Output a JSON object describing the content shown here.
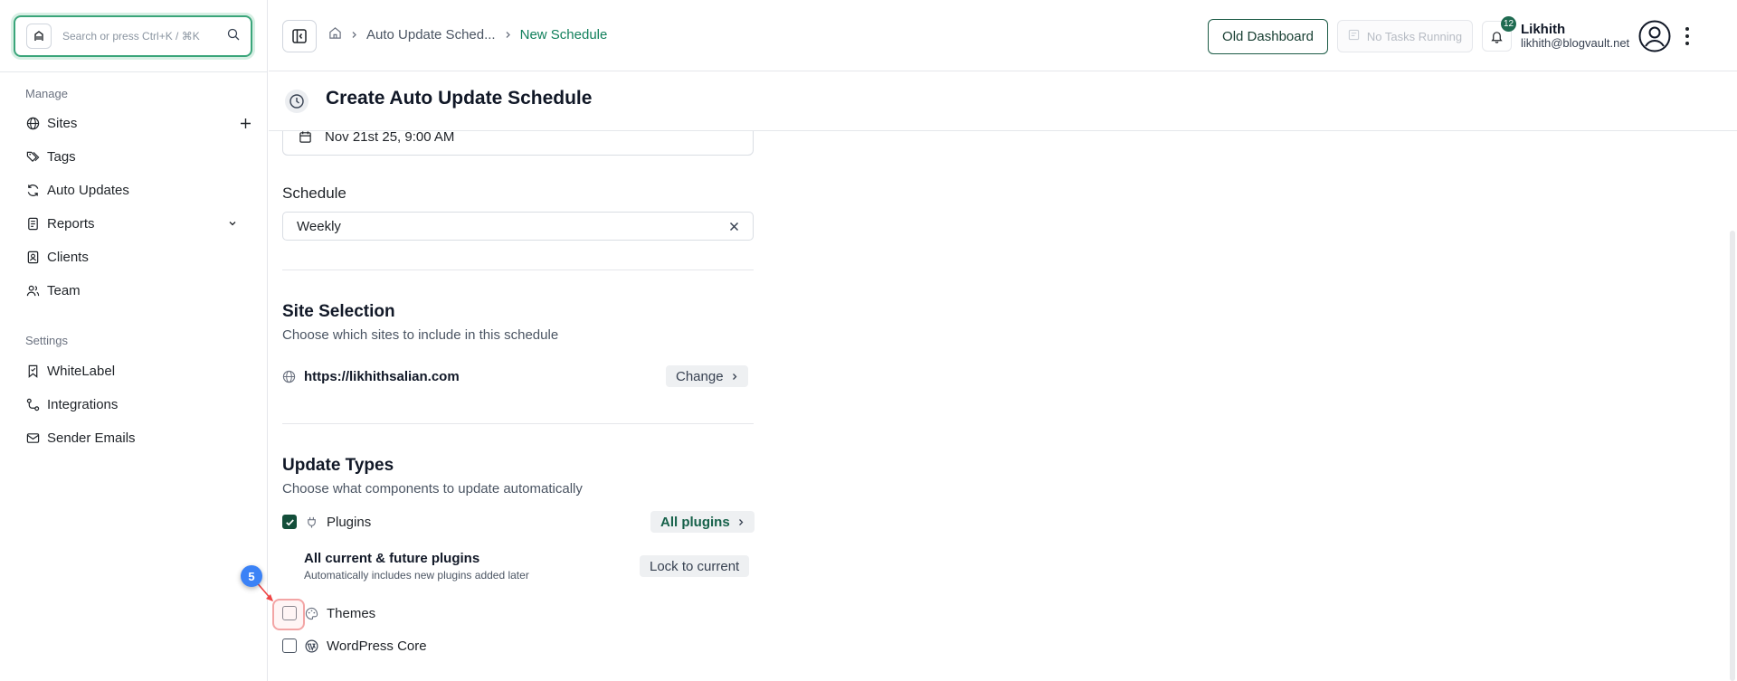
{
  "search": {
    "placeholder": "Search or press Ctrl+K / ⌘K"
  },
  "sidebar": {
    "manage_label": "Manage",
    "manage_items": [
      {
        "label": "Sites",
        "icon": "globe-icon",
        "trail": "plus-icon"
      },
      {
        "label": "Tags",
        "icon": "tags-icon"
      },
      {
        "label": "Auto Updates",
        "icon": "refresh-icon"
      },
      {
        "label": "Reports",
        "icon": "report-icon",
        "trail": "chevron-down-icon"
      },
      {
        "label": "Clients",
        "icon": "contact-icon"
      },
      {
        "label": "Team",
        "icon": "users-icon"
      }
    ],
    "settings_label": "Settings",
    "settings_items": [
      {
        "label": "WhiteLabel",
        "icon": "bookmark-icon"
      },
      {
        "label": "Integrations",
        "icon": "route-icon"
      },
      {
        "label": "Sender Emails",
        "icon": "mail-icon"
      }
    ]
  },
  "header": {
    "breadcrumb": {
      "parent": "Auto Update Sched...",
      "current": "New Schedule"
    },
    "old_dashboard": "Old Dashboard",
    "tasks_status": "No Tasks Running",
    "notification_count": "12",
    "user": {
      "name": "Likhith",
      "email": "likhith@blogvault.net"
    }
  },
  "page": {
    "title": "Create Auto Update Schedule"
  },
  "form": {
    "start_date": "Nov 21st 25, 9:00 AM",
    "schedule_label": "Schedule",
    "schedule_value": "Weekly",
    "site_selection": {
      "title": "Site Selection",
      "description": "Choose which sites to include in this schedule",
      "site": "https://likhithsalian.com",
      "change_label": "Change"
    },
    "update_types": {
      "title": "Update Types",
      "description": "Choose what components to update automatically",
      "plugins_label": "Plugins",
      "plugins_checked": true,
      "all_plugins_label": "All plugins",
      "future_title": "All current & future plugins",
      "future_desc": "Automatically includes new plugins added later",
      "lock_label": "Lock to current",
      "themes_label": "Themes",
      "themes_checked": false,
      "core_label": "WordPress Core",
      "core_checked": false
    }
  },
  "annotation": {
    "step": "5"
  },
  "colors": {
    "accent": "#12805c",
    "checkbox_checked": "#134e3a",
    "step_badge": "#3b82f6"
  }
}
